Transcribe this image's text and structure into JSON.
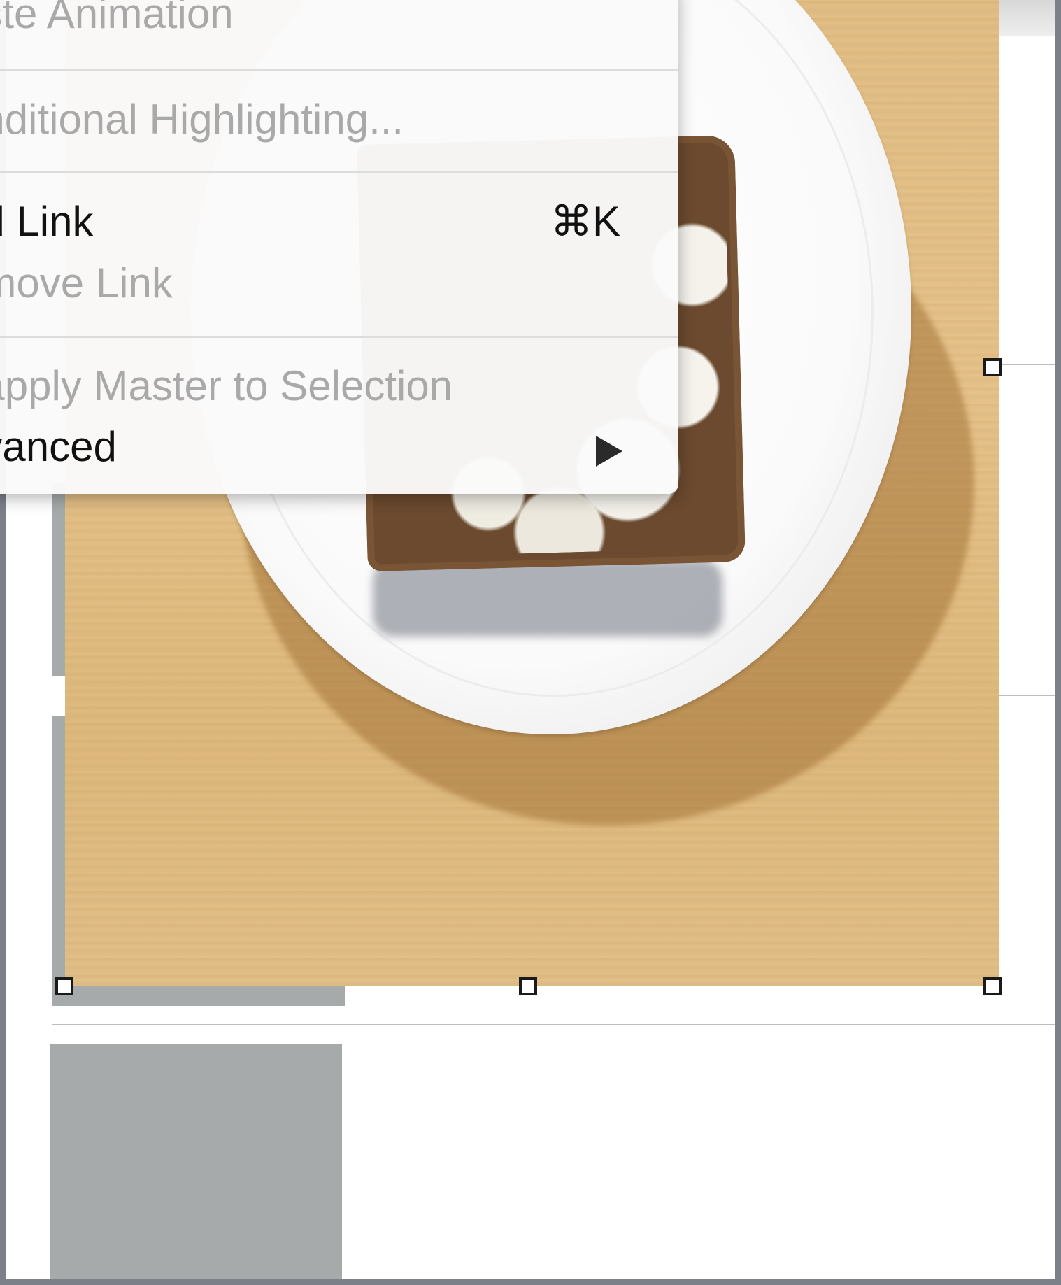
{
  "context_menu": {
    "items": [
      {
        "label": "aste Animation",
        "enabled": false
      },
      {
        "label": "onditional Highlighting...",
        "enabled": false
      },
      {
        "label": "dd Link",
        "enabled": true,
        "shortcut": "⌘K"
      },
      {
        "label": "emove Link",
        "enabled": false
      },
      {
        "label": "eapply Master to Selection",
        "enabled": false
      },
      {
        "label": "dvanced",
        "enabled": true,
        "submenu_icon": "right-triangle-icon"
      }
    ]
  },
  "colors": {
    "window_border": "#7c8088",
    "slide_background": "#ffffff",
    "placeholder_gray": "#a6aaaa",
    "menu_background": "#fafafa",
    "menu_text_enabled": "#111111",
    "menu_text_disabled": "#a9a9a9"
  },
  "selection": {
    "handles": [
      "top-right-mid",
      "bottom-left",
      "bottom-center",
      "bottom-right"
    ]
  }
}
